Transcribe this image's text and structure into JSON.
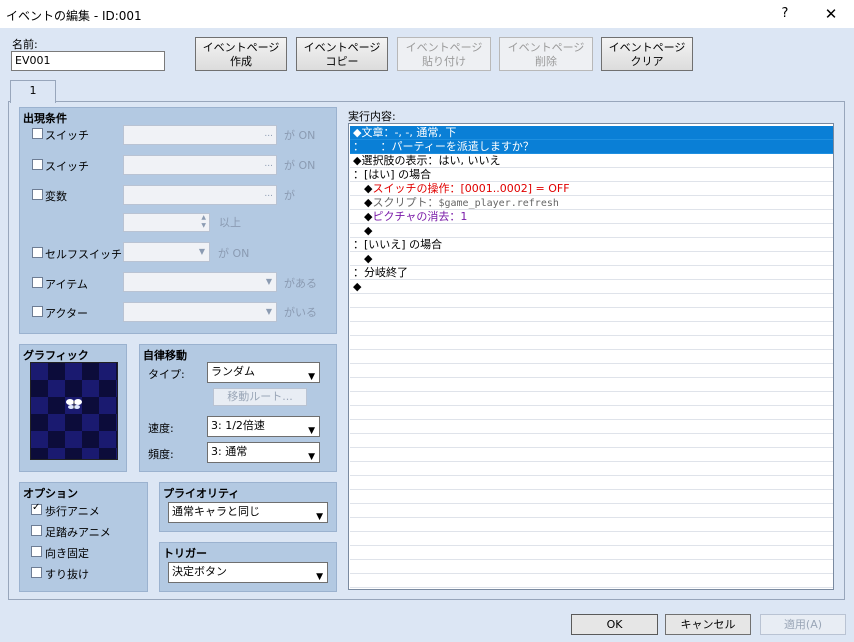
{
  "window": {
    "title": "イベントの編集 - ID:001",
    "help": "?",
    "close": "✕"
  },
  "name": {
    "label": "名前:",
    "value": "EV001"
  },
  "toolbar": [
    {
      "line1": "イベントページ",
      "line2": "作成",
      "enabled": true
    },
    {
      "line1": "イベントページ",
      "line2": "コピー",
      "enabled": true
    },
    {
      "line1": "イベントページ",
      "line2": "貼り付け",
      "enabled": false
    },
    {
      "line1": "イベントページ",
      "line2": "削除",
      "enabled": false
    },
    {
      "line1": "イベントページ",
      "line2": "クリア",
      "enabled": true
    }
  ],
  "tab": {
    "label": "1"
  },
  "conditions": {
    "title": "出現条件",
    "switch1": {
      "label": "スイッチ",
      "suffix": "が ON"
    },
    "switch2": {
      "label": "スイッチ",
      "suffix": "が ON"
    },
    "variable": {
      "label": "変数",
      "suffix": "が",
      "suffix2": "以上"
    },
    "self_switch": {
      "label": "セルフスイッチ",
      "suffix": "が ON"
    },
    "item": {
      "label": "アイテム",
      "suffix": "がある"
    },
    "actor": {
      "label": "アクター",
      "suffix": "がいる"
    },
    "dots": "..."
  },
  "graphic": {
    "title": "グラフィック"
  },
  "autonomous": {
    "title": "自律移動",
    "type_label": "タイプ:",
    "type_value": "ランダム",
    "route_button": "移動ルート...",
    "speed_label": "速度:",
    "speed_value": "3: 1/2倍速",
    "freq_label": "頻度:",
    "freq_value": "3: 通常"
  },
  "options": {
    "title": "オプション",
    "items": [
      {
        "label": "歩行アニメ",
        "checked": true
      },
      {
        "label": "足踏みアニメ",
        "checked": false
      },
      {
        "label": "向き固定",
        "checked": false
      },
      {
        "label": "すり抜け",
        "checked": false
      }
    ]
  },
  "priority": {
    "title": "プライオリティ",
    "value": "通常キャラと同じ"
  },
  "trigger": {
    "title": "トリガー",
    "value": "決定ボタン"
  },
  "contents": {
    "label": "実行内容:",
    "lines": [
      {
        "text": "◆文章：-, -, 通常, 下",
        "selected": true
      },
      {
        "text": "：　　：パーティーを派遣しますか？",
        "selected": true
      },
      {
        "text": "◆選択肢の表示：はい, いいえ"
      },
      {
        "text": "：[はい] の場合"
      },
      {
        "prefix": "　◆",
        "text": "スイッチの操作：[0001..0002] = OFF",
        "color": "red"
      },
      {
        "prefix": "　◆",
        "text": "スクリプト：",
        "text2": "$game_player.refresh",
        "color": "gray"
      },
      {
        "prefix": "　◆",
        "text": "ピクチャの消去：1",
        "color": "purple"
      },
      {
        "text": "　◆"
      },
      {
        "text": "：[いいえ] の場合"
      },
      {
        "text": "　◆"
      },
      {
        "text": "：分岐終了"
      },
      {
        "text": "◆"
      }
    ]
  },
  "buttons": {
    "ok": "OK",
    "cancel": "キャンセル",
    "apply": "適用(A)"
  },
  "glyphs": {
    "dropdown": "▼",
    "spin_up": "▲",
    "spin_down": "▼",
    "check": "✓"
  }
}
